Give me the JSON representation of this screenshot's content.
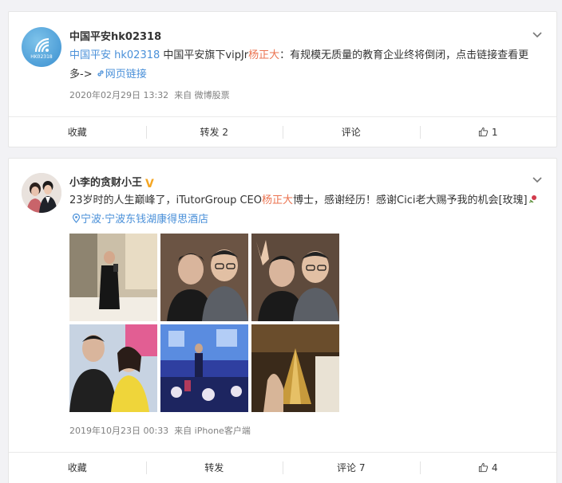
{
  "post1": {
    "avatar_text": "HK02318",
    "username": "中国平安hk02318",
    "text": {
      "mention": "中国平安 hk02318",
      "part1": " 中国平安旗下vipJr",
      "highlight": "杨正大",
      "part2": "：有规模无质量的教育企业终将倒闭，点击链接查看更多-> ",
      "link_text": "网页链接"
    },
    "timestamp": "2020年02月29日 13:32",
    "source": "来自 微博股票",
    "actions": {
      "favorite": "收藏",
      "repost": "转发 2",
      "comment": "评论",
      "like_count": "1"
    }
  },
  "post2": {
    "username": "小李的贪财小王",
    "verified_icon": "v-badge-icon",
    "text": {
      "part1": "23岁时的人生巅峰了，iTutorGroup CEO",
      "highlight": "杨正大",
      "part2": "博士，感谢经历！感谢Cici老大赐予我的机会[玫瑰]",
      "location": "宁波·宁波东钱湖康得思酒店"
    },
    "photos": [
      "photo-mirror-selfie",
      "photo-two-men-1",
      "photo-two-men-2",
      "photo-with-woman",
      "photo-stage",
      "photo-trophy"
    ],
    "timestamp": "2019年10月23日 00:33",
    "source": "来自 iPhone客户端",
    "actions": {
      "favorite": "收藏",
      "repost": "转发",
      "comment": "评论 7",
      "like_count": "4"
    }
  },
  "colors": {
    "highlight": "#eb7350",
    "link_blue": "#4a90d9",
    "meta_gray": "#808080"
  }
}
